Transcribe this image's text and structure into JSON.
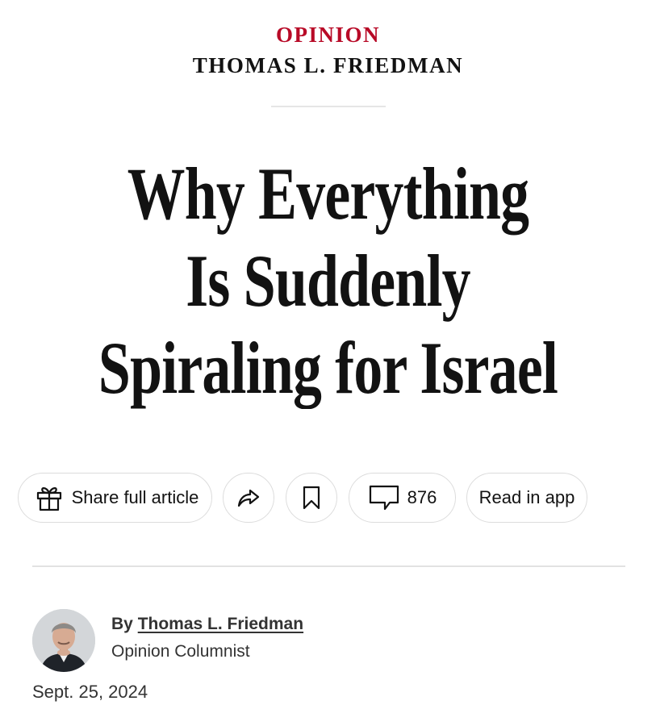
{
  "header": {
    "section": "OPINION",
    "columnist": "THOMAS L. FRIEDMAN"
  },
  "headline": {
    "lines": [
      "Why Everything",
      "Is Suddenly",
      "Spiraling for Israel"
    ]
  },
  "actions": {
    "share_label": "Share full article",
    "comment_count": "876",
    "read_in_app_label": "Read in app"
  },
  "byline": {
    "prefix": "By",
    "author": "Thomas L. Friedman",
    "role": "Opinion Columnist",
    "date": "Sept. 25, 2024"
  },
  "colors": {
    "section_red": "#b80a27",
    "text": "#121212",
    "border": "#dcdcdc"
  },
  "icons": [
    "gift-icon",
    "share-arrow-icon",
    "bookmark-icon",
    "comment-bubble-icon"
  ]
}
